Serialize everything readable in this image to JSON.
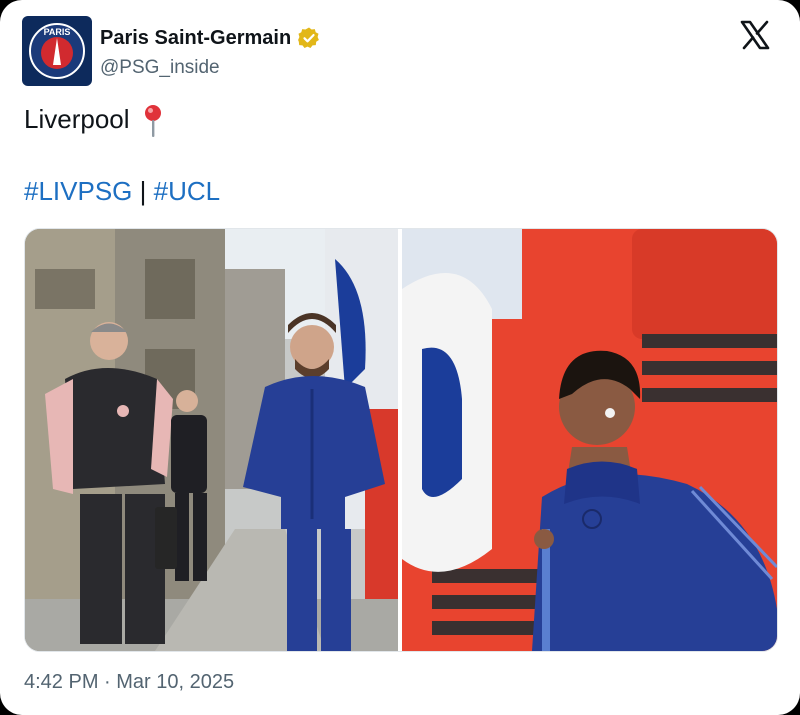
{
  "author": {
    "name": "Paris Saint-Germain",
    "handle": "@PSG_inside",
    "avatar_text": "PARIS",
    "avatar_icon": "psg-crest-icon"
  },
  "tweet": {
    "text": "Liverpool",
    "text_emoji_icon": "round-pushpin-icon",
    "hashtag1": "#LIVPSG",
    "separator": " | ",
    "hashtag2": "#UCL"
  },
  "media": {
    "photo_count": 2
  },
  "timestamp": "4:42 PM · Mar 10, 2025",
  "colors": {
    "link": "#1d6fc2",
    "verified": "#e2b719",
    "avatar_bg": "#0d2a5c",
    "bus_red": "#e8442f",
    "kit_navy": "#253f97"
  }
}
